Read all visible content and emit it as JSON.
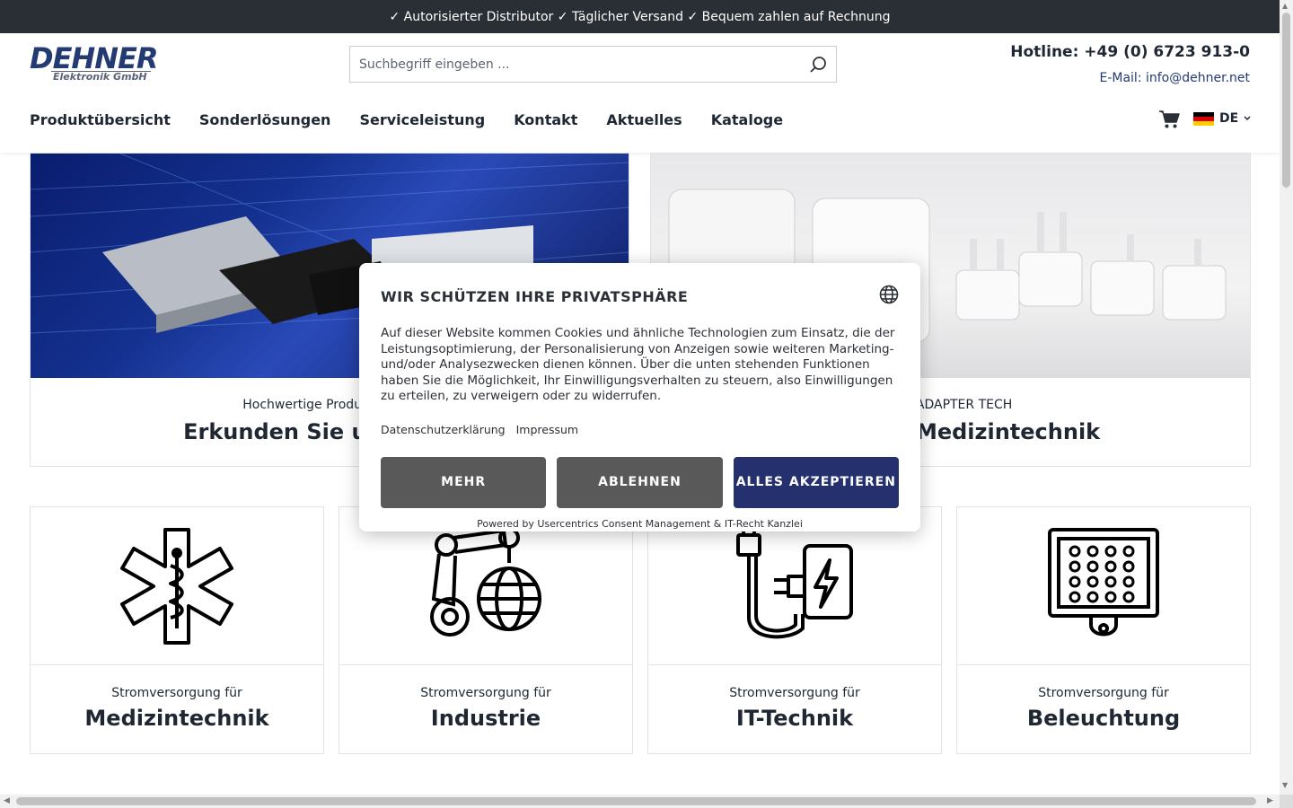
{
  "topbar": {
    "text": "✓ Autorisierter Distributor ✓ Täglicher Versand ✓ Bequem zahlen auf Rechnung"
  },
  "logo": {
    "line1": "DEHNER",
    "line2": "Elektronik GmbH"
  },
  "search": {
    "placeholder": "Suchbegriff eingeben ...",
    "icon": "search-icon"
  },
  "contact": {
    "hotline": "Hotline: +49 (0) 6723 913-0",
    "email": "E-Mail: info@dehner.net"
  },
  "nav": {
    "items": [
      "Produktübersicht",
      "Sonderlösungen",
      "Serviceleistung",
      "Kontakt",
      "Aktuelles",
      "Kataloge"
    ]
  },
  "language": {
    "code": "DE"
  },
  "heroes": [
    {
      "sub": "Hochwertige Produkte nach",
      "title": "Erkunden Sie unser Neu"
    },
    {
      "sub": "von ADAPTER TECH",
      "title": "eräte für Medizintechnik"
    }
  ],
  "categories": [
    {
      "sub": "Stromversorgung für",
      "title": "Medizintechnik",
      "icon": "star-of-life-icon"
    },
    {
      "sub": "Stromversorgung für",
      "title": "Industrie",
      "icon": "robot-arm-globe-icon"
    },
    {
      "sub": "Stromversorgung für",
      "title": "IT-Technik",
      "icon": "power-adapter-icon"
    },
    {
      "sub": "Stromversorgung für",
      "title": "Beleuchtung",
      "icon": "led-panel-icon"
    }
  ],
  "consent": {
    "title": "WIR SCHÜTZEN IHRE PRIVATSPHÄRE",
    "body": "Auf dieser Website kommen Cookies und ähnliche Technologien zum Einsatz, die der Leistungsoptimierung, der Personalisierung von Anzeigen sowie weiteren Marketing- und/oder Analysezwecken dienen können. Über die unten stehenden Funktionen haben Sie die Möglichkeit, Ihr Einwilligungsverhalten zu steuern, also Einwilligungen zu erteilen, zu verweigern oder zu widerrufen.",
    "link_privacy": "Datenschutzerklärung",
    "link_imprint": "Impressum",
    "btn_more": "MEHR",
    "btn_decline": "ABLEHNEN",
    "btn_accept": "ALLES AKZEPTIEREN",
    "powered": "Powered by Usercentrics Consent Management & IT-Recht Kanzlei"
  },
  "colors": {
    "brand": "#243a73",
    "topbar": "#2a2e35",
    "accept": "#25316f",
    "grey_button": "#595959"
  }
}
